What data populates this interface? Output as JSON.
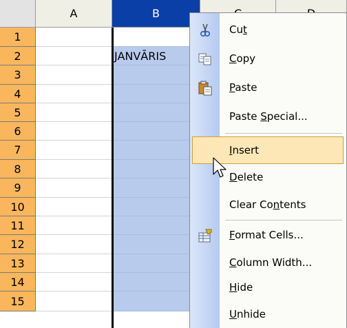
{
  "columns": [
    {
      "label": "A",
      "selected": false
    },
    {
      "label": "B",
      "selected": true
    },
    {
      "label": "C",
      "selected": false
    },
    {
      "label": "D",
      "selected": false
    }
  ],
  "rows": [
    "1",
    "2",
    "3",
    "4",
    "5",
    "6",
    "7",
    "8",
    "9",
    "10",
    "11",
    "12",
    "13",
    "14",
    "15"
  ],
  "cells": {
    "B2": "JANVĀRIS"
  },
  "context_menu": {
    "items": [
      {
        "id": "cut",
        "pre": "Cu",
        "ul": "t",
        "post": "",
        "icon": "scissors-icon"
      },
      {
        "id": "copy",
        "pre": "",
        "ul": "C",
        "post": "opy",
        "icon": "copy-icon"
      },
      {
        "id": "paste",
        "pre": "",
        "ul": "P",
        "post": "aste",
        "icon": "paste-icon"
      },
      {
        "id": "paste-special",
        "pre": "Paste ",
        "ul": "S",
        "post": "pecial...",
        "icon": ""
      },
      {
        "id": "insert",
        "pre": "",
        "ul": "I",
        "post": "nsert",
        "icon": "",
        "hover": true
      },
      {
        "id": "delete",
        "pre": "",
        "ul": "D",
        "post": "elete",
        "icon": ""
      },
      {
        "id": "clear-contents",
        "pre": "Clear Co",
        "ul": "n",
        "post": "tents",
        "icon": ""
      },
      {
        "id": "format-cells",
        "pre": "",
        "ul": "F",
        "post": "ormat Cells...",
        "icon": "format-cells-icon"
      },
      {
        "id": "column-width",
        "pre": "",
        "ul": "C",
        "post": "olumn Width...",
        "icon": ""
      },
      {
        "id": "hide",
        "pre": "",
        "ul": "H",
        "post": "ide",
        "icon": ""
      },
      {
        "id": "unhide",
        "pre": "",
        "ul": "U",
        "post": "nhide",
        "icon": ""
      }
    ]
  },
  "colors": {
    "selected_header": "#0a3fa7",
    "row_header": "#f9b65c",
    "selection_fill": "#b8cbec",
    "menu_hover": "#fde7b7"
  }
}
